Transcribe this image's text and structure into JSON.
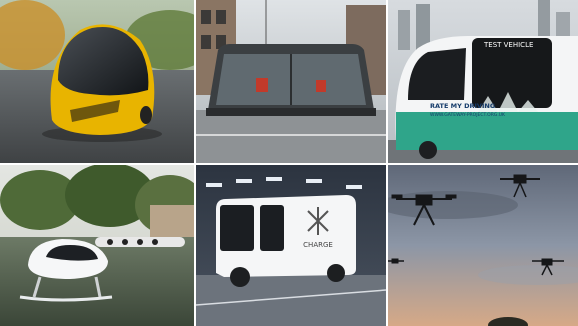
{
  "collage": {
    "tiles": [
      {
        "subject": "yellow-pod-vehicle"
      },
      {
        "subject": "glass-autonomous-shuttle"
      },
      {
        "subject": "test-vehicle-shuttle",
        "banner": "TEST VEHICLE",
        "slogan": "RATE MY DRIVING",
        "site": "WWW.GATEWAY-PROJECT.ORG.UK"
      },
      {
        "subject": "hydrofoil-water-taxi"
      },
      {
        "subject": "charge-electric-van",
        "brand": "CHARGE"
      },
      {
        "subject": "delivery-drones"
      }
    ]
  },
  "colors": {
    "pod_yellow": "#e8b400",
    "shuttle_teal": "#2fa58a",
    "drone_sky": "#8c96a6"
  }
}
